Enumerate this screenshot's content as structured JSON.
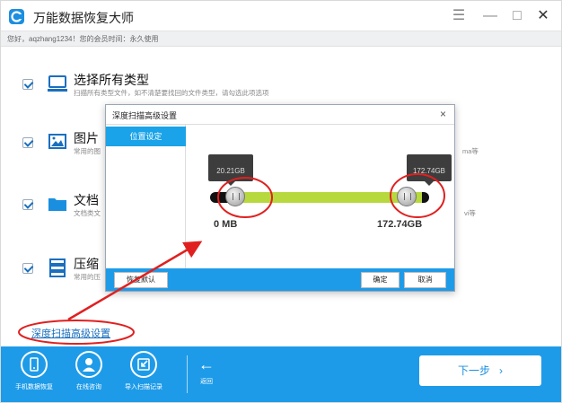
{
  "window": {
    "title": "万能数据恢复大师",
    "greeting": "您好，aqzhang1234！您的会员时间：永久使用",
    "menu_icon": "☰",
    "min_icon": "—",
    "max_icon": "□",
    "close_icon": "✕"
  },
  "types": [
    {
      "label": "选择所有类型",
      "desc": "扫描所有类型文件，如不清楚要找回的文件类型，请勾选此项选项",
      "tail": ""
    },
    {
      "label": "图片",
      "desc": "常用的图",
      "tail": "ma等"
    },
    {
      "label": "文档",
      "desc": "文档类文",
      "tail": "vi等"
    },
    {
      "label": "压缩",
      "desc": "常用的压",
      "tail": ""
    }
  ],
  "advanced_link": "深度扫描高级设置",
  "bottom": {
    "items": [
      {
        "label": "手机数据恢复"
      },
      {
        "label": "在线咨询"
      },
      {
        "label": "导入扫描记录"
      }
    ],
    "back_arrow": "←",
    "back_label": "返回",
    "next_label": "下一步",
    "next_chevron": "›"
  },
  "dialog": {
    "title": "深度扫描高级设置",
    "close": "×",
    "tab": "位置设定",
    "slider": {
      "min_value_label": "20.21GB",
      "max_value_label": "172.74GB",
      "min_label": "0 MB",
      "max_label": "172.74GB",
      "selected_low_fraction": 0.117,
      "selected_high_fraction": 1.0
    },
    "restore_label": "恢复默认",
    "ok_label": "确定",
    "cancel_label": "取消"
  },
  "colors": {
    "accent": "#1e9be8",
    "slider_fill": "#b7d93e",
    "annotation": "#e02020"
  }
}
